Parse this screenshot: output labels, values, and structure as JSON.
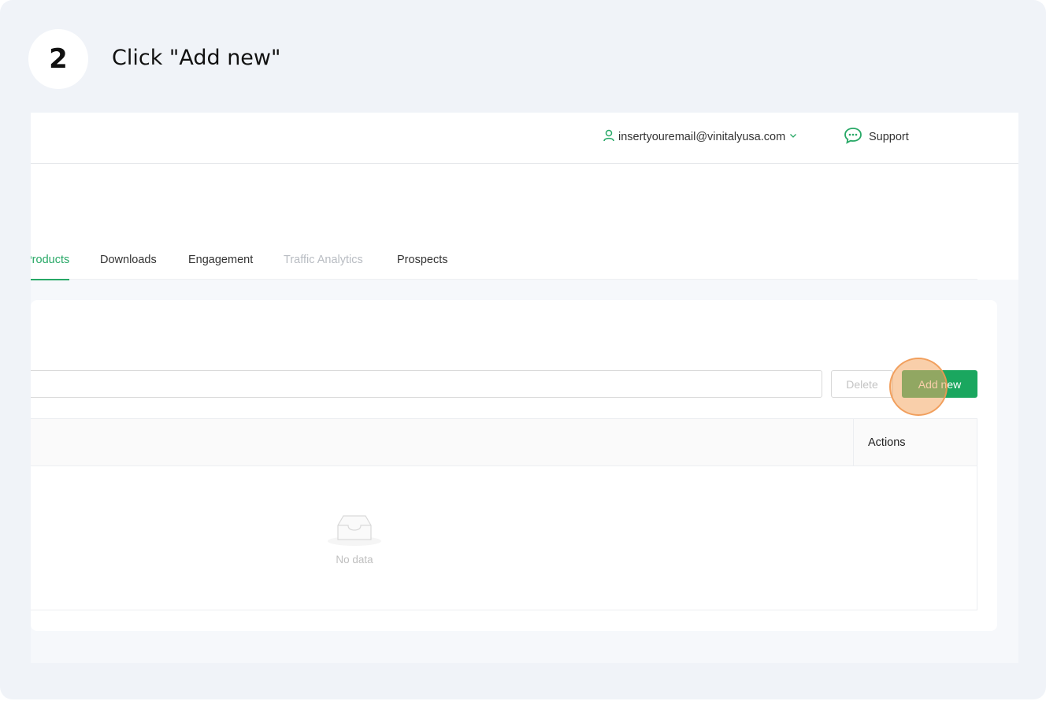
{
  "step": {
    "number": "2",
    "instruction": "Click \"Add new\""
  },
  "topbar": {
    "user_email": "insertyouremail@vinitalyusa.com",
    "support_label": "Support"
  },
  "tabs": [
    {
      "label": "Products",
      "state": "active"
    },
    {
      "label": "Downloads",
      "state": "normal"
    },
    {
      "label": "Engagement",
      "state": "normal"
    },
    {
      "label": "Traffic Analytics",
      "state": "disabled"
    },
    {
      "label": "Prospects",
      "state": "normal"
    }
  ],
  "toolbar": {
    "delete_label": "Delete",
    "add_label": "Add new"
  },
  "table": {
    "actions_header": "Actions",
    "empty_text": "No data"
  },
  "colors": {
    "accent": "#1aa75f",
    "background": "#f0f3f8",
    "click_marker": "#f4a864"
  }
}
